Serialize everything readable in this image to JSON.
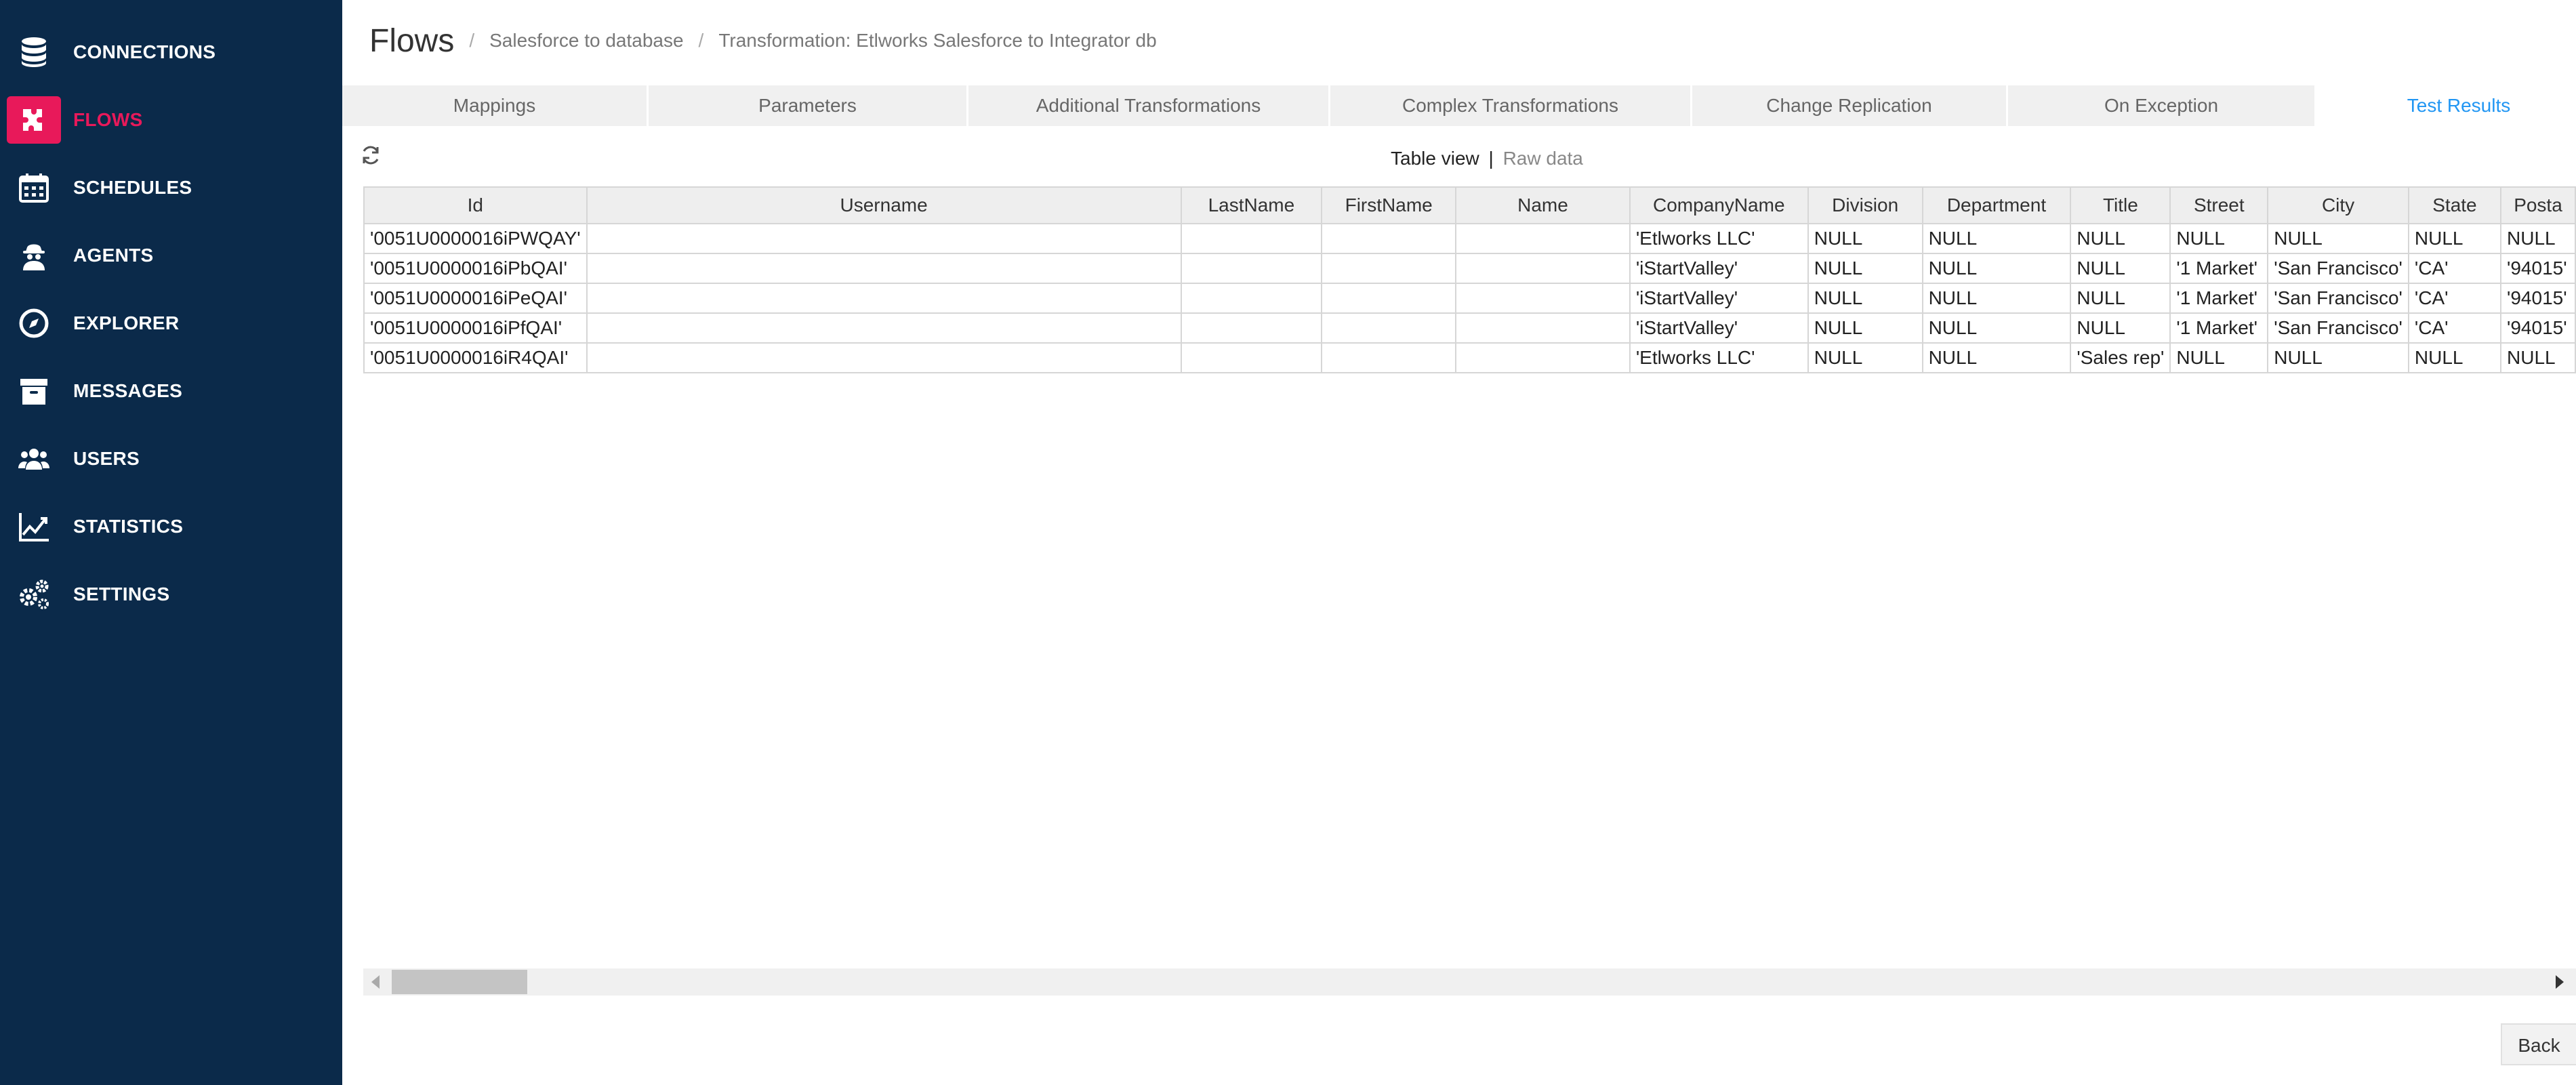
{
  "sidebar": {
    "items": [
      {
        "label": "CONNECTIONS",
        "icon": "database-icon"
      },
      {
        "label": "FLOWS",
        "icon": "puzzle-icon"
      },
      {
        "label": "SCHEDULES",
        "icon": "calendar-icon"
      },
      {
        "label": "AGENTS",
        "icon": "agent-icon"
      },
      {
        "label": "EXPLORER",
        "icon": "compass-icon"
      },
      {
        "label": "MESSAGES",
        "icon": "archive-icon"
      },
      {
        "label": "USERS",
        "icon": "users-icon"
      },
      {
        "label": "STATISTICS",
        "icon": "chart-line-icon"
      },
      {
        "label": "SETTINGS",
        "icon": "gears-icon"
      }
    ],
    "active_index": 1
  },
  "header": {
    "title": "Flows",
    "breadcrumbs": [
      "Salesforce to database",
      "Transformation: Etlworks Salesforce to Integrator db"
    ]
  },
  "tabs": [
    {
      "label": "Mappings"
    },
    {
      "label": "Parameters"
    },
    {
      "label": "Additional Transformations"
    },
    {
      "label": "Complex Transformations"
    },
    {
      "label": "Change Replication"
    },
    {
      "label": "On Exception"
    },
    {
      "label": "Test Results"
    }
  ],
  "active_tab": "Test Results",
  "view_switch": {
    "table": "Table view",
    "separator": "|",
    "raw": "Raw data"
  },
  "table": {
    "columns": [
      "Id",
      "Username",
      "LastName",
      "FirstName",
      "Name",
      "CompanyName",
      "Division",
      "Department",
      "Title",
      "Street",
      "City",
      "State",
      "Posta"
    ],
    "rows": [
      [
        "'0051U0000016iPWQAY'",
        "",
        "",
        "",
        "",
        "'Etlworks LLC'",
        "NULL",
        "NULL",
        "NULL",
        "NULL",
        "NULL",
        "NULL",
        "NULL"
      ],
      [
        "'0051U0000016iPbQAI'",
        "",
        "",
        "",
        "",
        "'iStartValley'",
        "NULL",
        "NULL",
        "NULL",
        "'1 Market'",
        "'San Francisco'",
        "'CA'",
        "'94015'"
      ],
      [
        "'0051U0000016iPeQAI'",
        "",
        "",
        "",
        "",
        "'iStartValley'",
        "NULL",
        "NULL",
        "NULL",
        "'1 Market'",
        "'San Francisco'",
        "'CA'",
        "'94015'"
      ],
      [
        "'0051U0000016iPfQAI'",
        "",
        "",
        "",
        "",
        "'iStartValley'",
        "NULL",
        "NULL",
        "NULL",
        "'1 Market'",
        "'San Francisco'",
        "'CA'",
        "'94015'"
      ],
      [
        "'0051U0000016iR4QAI'",
        "",
        "",
        "",
        "",
        "'Etlworks LLC'",
        "NULL",
        "NULL",
        "'Sales rep'",
        "NULL",
        "NULL",
        "NULL",
        "NULL"
      ]
    ]
  },
  "buttons": {
    "back": "Back"
  },
  "colors": {
    "sidebar_bg": "#0b2a4a",
    "accent": "#e8195a",
    "tab_active": "#2196f3"
  }
}
